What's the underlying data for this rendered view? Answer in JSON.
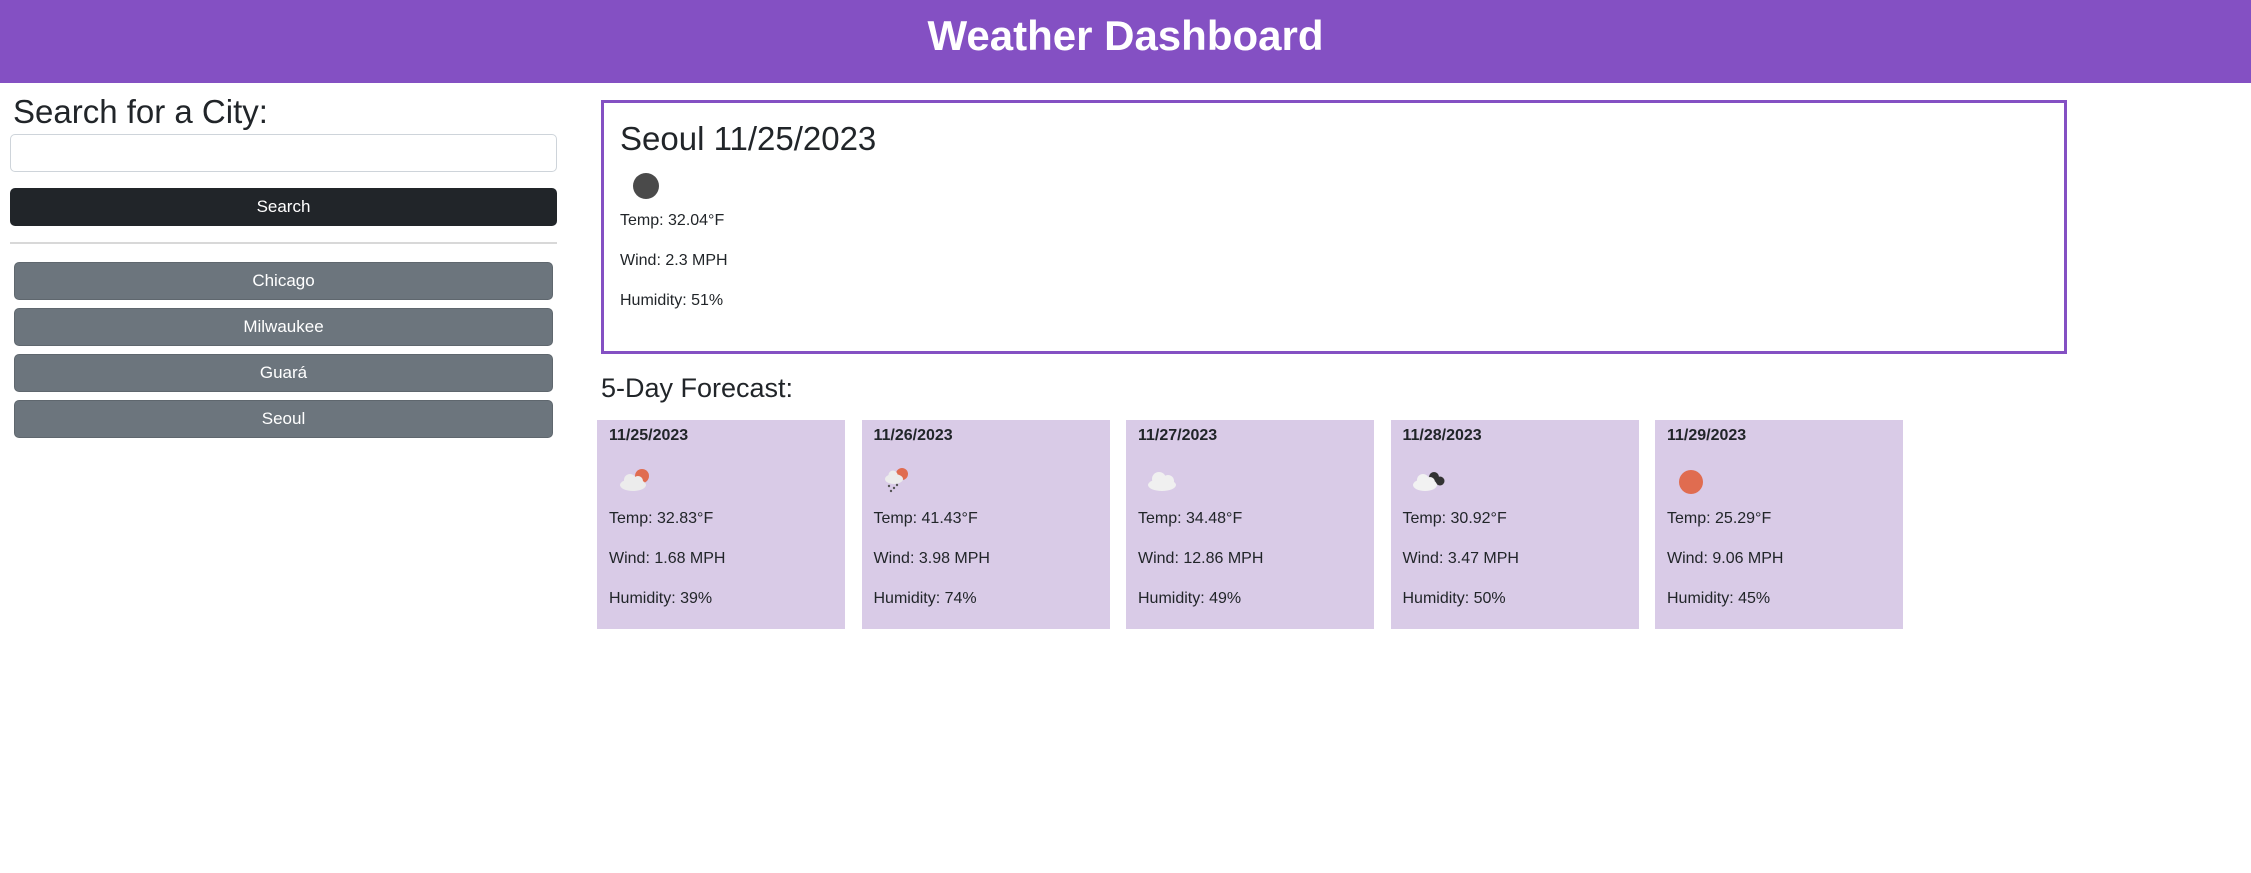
{
  "header": {
    "title": "Weather Dashboard"
  },
  "sidebar": {
    "heading": "Search for a City:",
    "search_value": "",
    "search_button": "Search",
    "history": [
      "Chicago",
      "Milwaukee",
      "Guará",
      "Seoul"
    ]
  },
  "current": {
    "title": "Seoul 11/25/2023",
    "icon": "moon-icon",
    "temp": "Temp: 32.04°F",
    "wind": "Wind: 2.3 MPH",
    "humidity": "Humidity: 51%"
  },
  "forecast": {
    "title": "5-Day Forecast:",
    "days": [
      {
        "date": "11/25/2023",
        "icon": "partly-cloudy-icon",
        "temp": "Temp: 32.83°F",
        "wind": "Wind: 1.68 MPH",
        "humidity": "Humidity: 39%"
      },
      {
        "date": "11/26/2023",
        "icon": "snow-sun-icon",
        "temp": "Temp: 41.43°F",
        "wind": "Wind: 3.98 MPH",
        "humidity": "Humidity: 74%"
      },
      {
        "date": "11/27/2023",
        "icon": "cloud-icon",
        "temp": "Temp: 34.48°F",
        "wind": "Wind: 12.86 MPH",
        "humidity": "Humidity: 49%"
      },
      {
        "date": "11/28/2023",
        "icon": "broken-clouds-icon",
        "temp": "Temp: 30.92°F",
        "wind": "Wind: 3.47 MPH",
        "humidity": "Humidity: 50%"
      },
      {
        "date": "11/29/2023",
        "icon": "sun-icon",
        "temp": "Temp: 25.29°F",
        "wind": "Wind: 9.06 MPH",
        "humidity": "Humidity: 45%"
      }
    ]
  },
  "colors": {
    "header": "#8450c3",
    "card_bg": "#d9cbe7",
    "search_btn": "#212529",
    "history_btn": "#6c757d",
    "sun": "#e06c50"
  }
}
